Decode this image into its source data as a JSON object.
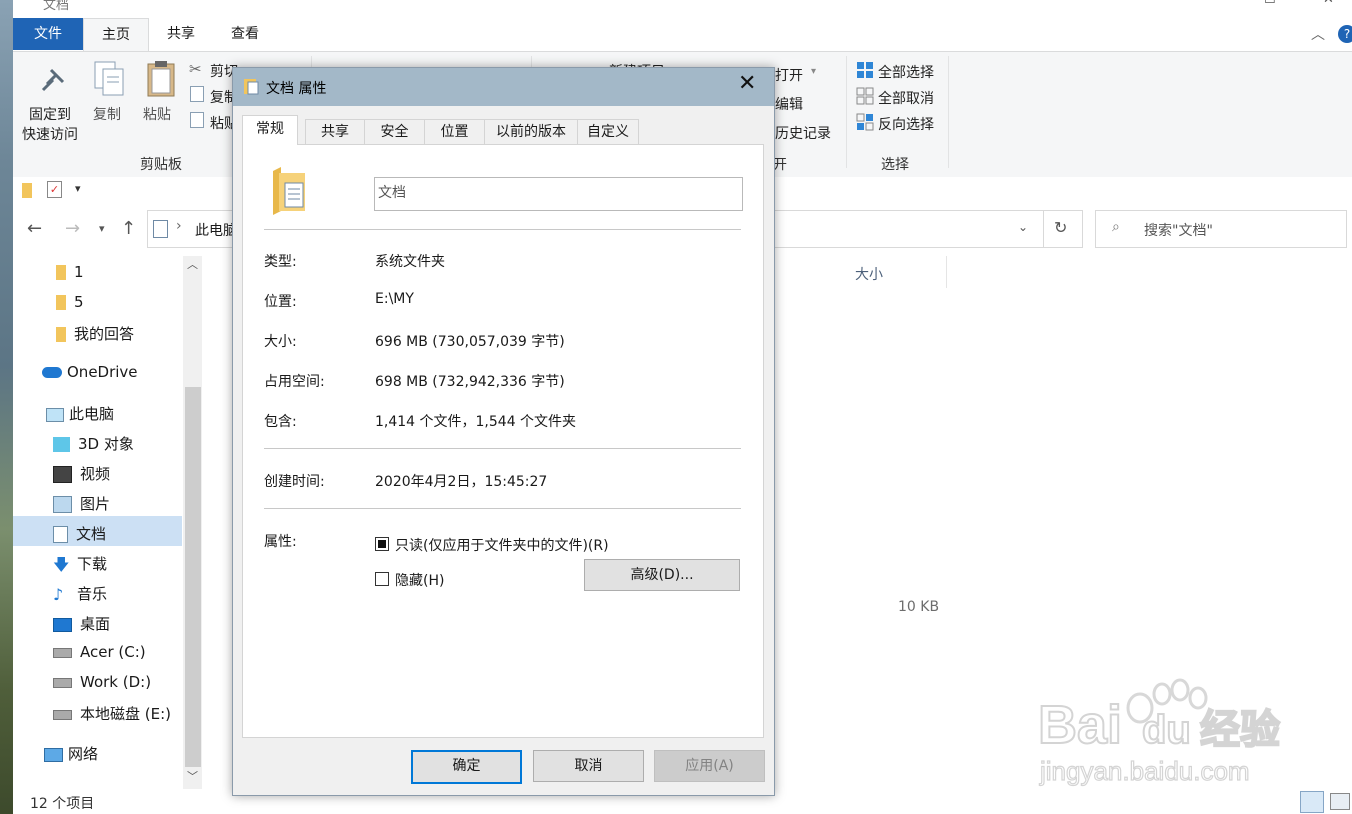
{
  "window": {
    "title": "文档"
  },
  "ribbon": {
    "tabs": [
      "文件",
      "主页",
      "共享",
      "查看"
    ],
    "pin_label_1": "固定到",
    "pin_label_2": "快速访问",
    "copy_label": "复制",
    "paste_label": "粘贴",
    "cut_label": "剪切",
    "copy_path_label": "复制",
    "paste_shortcut_label": "粘贴",
    "clipboard_group": "剪贴板",
    "new_item_label": "新建项目",
    "open_label": "打开",
    "edit_label": "编辑",
    "history_label": "历史记录",
    "open_group": "开",
    "select_all_label": "全部选择",
    "select_none_label": "全部取消",
    "invert_label": "反向选择",
    "select_group": "选择"
  },
  "address": {
    "breadcrumb_root": "此电脑",
    "search_placeholder": "搜索\"文档\""
  },
  "nav": {
    "items": [
      {
        "label": "1"
      },
      {
        "label": "5"
      },
      {
        "label": "我的回答"
      },
      {
        "label": "OneDrive"
      },
      {
        "label": "此电脑"
      },
      {
        "label": "3D 对象"
      },
      {
        "label": "视频"
      },
      {
        "label": "图片"
      },
      {
        "label": "文档"
      },
      {
        "label": "下载"
      },
      {
        "label": "音乐"
      },
      {
        "label": "桌面"
      },
      {
        "label": "Acer (C:)"
      },
      {
        "label": "Work (D:)"
      },
      {
        "label": "本地磁盘 (E:)"
      },
      {
        "label": "网络"
      }
    ]
  },
  "content": {
    "size_header": "大小",
    "file_size": "10 KB"
  },
  "status": {
    "item_count": "12 个项目"
  },
  "dialog": {
    "title": "文档 属性",
    "tabs": [
      "常规",
      "共享",
      "安全",
      "位置",
      "以前的版本",
      "自定义"
    ],
    "name_value": "文档",
    "type_label": "类型:",
    "type_value": "系统文件夹",
    "location_label": "位置:",
    "location_value": "E:\\MY",
    "size_label": "大小:",
    "size_value": "696 MB (730,057,039 字节)",
    "disk_label": "占用空间:",
    "disk_value": "698 MB (732,942,336 字节)",
    "contains_label": "包含:",
    "contains_value": "1,414 个文件，1,544 个文件夹",
    "created_label": "创建时间:",
    "created_value": "2020年4月2日，15:45:27",
    "attributes_label": "属性:",
    "readonly_label": "只读(仅应用于文件夹中的文件)(R)",
    "readonly_checked": true,
    "hidden_label": "隐藏(H)",
    "hidden_checked": false,
    "advanced_button": "高级(D)...",
    "ok_button": "确定",
    "cancel_button": "取消",
    "apply_button": "应用(A)"
  },
  "watermark": {
    "brand": "Bai du 经验",
    "url": "jingyan.baidu.com"
  },
  "colors": {
    "accent": "#1f64b5",
    "selection": "#cce0f4",
    "dialog_title": "#a3b8c8",
    "folder": "#f2c55c"
  }
}
